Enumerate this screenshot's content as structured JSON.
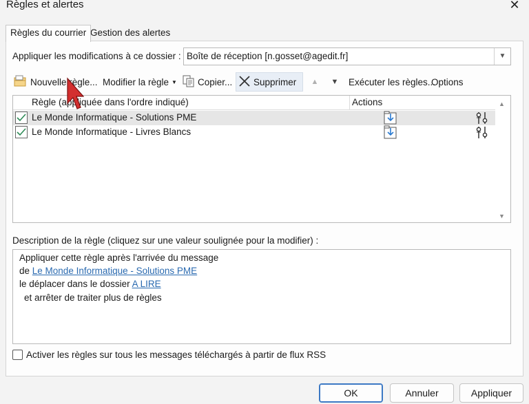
{
  "window": {
    "title": "Règles et alertes"
  },
  "tabs": [
    {
      "label": "Règles du courrier",
      "active": true
    },
    {
      "label": "Gestion des alertes",
      "active": false
    }
  ],
  "folder": {
    "label": "Appliquer les modifications à ce dossier :",
    "value": "Boîte de réception [n.gosset@agedit.fr]"
  },
  "toolbar": {
    "new_rule": "Nouvelle règle...",
    "modify_rule": "Modifier la règle",
    "copy": "Copier...",
    "delete": "Supprimer",
    "run_rules": "Exécuter les règles...",
    "options": "Options"
  },
  "rules_list": {
    "columns": {
      "rule": "Règle (appliquée dans l'ordre indiqué)",
      "actions": "Actions"
    },
    "rows": [
      {
        "label": "Le Monde Informatique - Solutions PME",
        "checked": true,
        "selected": true
      },
      {
        "label": "Le Monde Informatique - Livres Blancs",
        "checked": true,
        "selected": false
      }
    ]
  },
  "description": {
    "label": "Description de la règle (cliquez sur une valeur soulignée pour la modifier) :",
    "line1": "Appliquer cette règle après l'arrivée du message",
    "line2_prefix": "de ",
    "line2_link": "Le Monde Informatique - Solutions PME",
    "line3_prefix": "le déplacer dans le dossier ",
    "line3_link": "A LIRE",
    "line4": "et arrêter de traiter plus de règles"
  },
  "rss": {
    "label": "Activer les règles sur tous les messages téléchargés à partir de flux RSS",
    "checked": false
  },
  "buttons": {
    "ok": "OK",
    "cancel": "Annuler",
    "apply": "Appliquer"
  },
  "colors": {
    "accent": "#3b78c4",
    "link": "#2a6ab0",
    "check": "#2e8b57",
    "cursor": "#d32f2f"
  }
}
